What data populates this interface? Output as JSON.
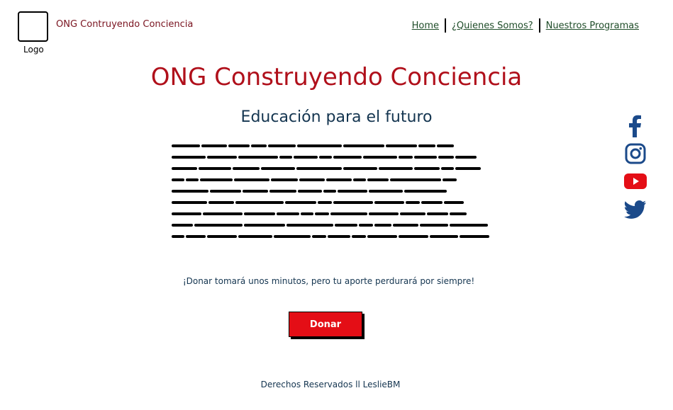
{
  "header": {
    "logo_label": "Logo",
    "brand_name": "ONG Contruyendo Conciencia",
    "nav": [
      {
        "label": "Home"
      },
      {
        "label": "¿Quienes Somos?"
      },
      {
        "label": "Nuestros Programas"
      }
    ]
  },
  "main": {
    "title": "ONG Construyendo Conciencia",
    "subtitle": "Educación para el futuro",
    "donate_note": "¡Donar tomará unos minutos, pero tu aporte perdurará por siempre!",
    "donate_button": "Donar"
  },
  "social": [
    {
      "icon": "facebook-icon",
      "color": "#1b4a8a"
    },
    {
      "icon": "instagram-icon",
      "color": "#1b4a8a"
    },
    {
      "icon": "youtube-icon",
      "color": "#e40e16"
    },
    {
      "icon": "twitter-icon",
      "color": "#1b4a8a"
    }
  ],
  "footer": {
    "text": "Derechos Reservados ll LeslieBM"
  },
  "colors": {
    "brand": "#7a1420",
    "title": "#b0101b",
    "text": "#143550",
    "nav": "#1f4d29",
    "button": "#e40e16"
  }
}
